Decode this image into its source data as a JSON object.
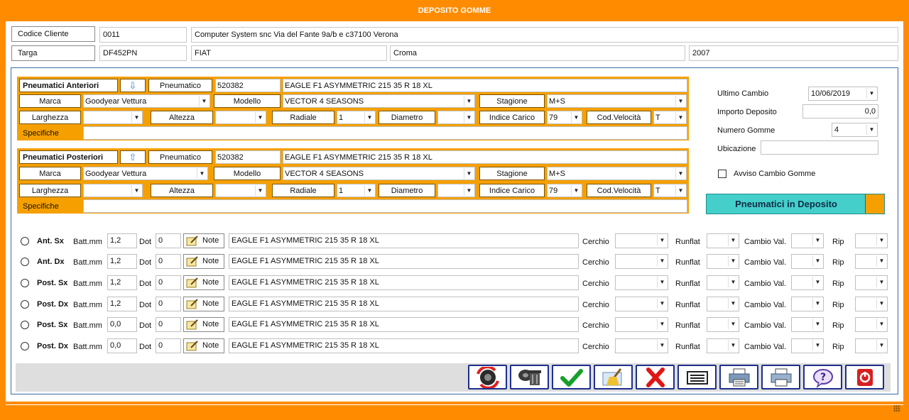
{
  "window": {
    "title": "DEPOSITO GOMME"
  },
  "header": {
    "codice_label": "Codice Cliente",
    "codice_value": "0011",
    "cliente_value": "Computer System snc Via del Fante 9a/b e c37100 Verona",
    "targa_label": "Targa",
    "targa_value": "DF452PN",
    "marca_value": "FIAT",
    "modello_value": "Croma",
    "anno_value": "2007"
  },
  "anteriori": {
    "title": "Pneumatici Anteriori",
    "pneumatico_btn": "Pneumatico",
    "codice": "520382",
    "descrizione": "EAGLE F1 ASYMMETRIC 215 35 R 18 XL",
    "marca_label": "Marca",
    "marca_value": "Goodyear Vettura",
    "modello_label": "Modello",
    "modello_value": "VECTOR 4 SEASONS",
    "stagione_label": "Stagione",
    "stagione_value": "M+S",
    "larghezza_label": "Larghezza",
    "larghezza_value": "",
    "altezza_label": "Altezza",
    "altezza_value": "",
    "radiale_label": "Radiale",
    "radiale_value": "1",
    "diametro_label": "Diametro",
    "diametro_value": "",
    "indice_label": "Indice Carico",
    "indice_value": "79",
    "velocita_label": "Cod.Velocità",
    "velocita_value": "T",
    "specifiche_label": "Specifiche",
    "specifiche_value": ""
  },
  "posteriori": {
    "title": "Pneumatici Posteriori",
    "pneumatico_btn": "Pneumatico",
    "codice": "520382",
    "descrizione": "EAGLE F1 ASYMMETRIC 215 35 R 18 XL",
    "marca_label": "Marca",
    "marca_value": "Goodyear Vettura",
    "modello_label": "Modello",
    "modello_value": "VECTOR 4 SEASONS",
    "stagione_label": "Stagione",
    "stagione_value": "M+S",
    "larghezza_label": "Larghezza",
    "larghezza_value": "",
    "altezza_label": "Altezza",
    "altezza_value": "",
    "radiale_label": "Radiale",
    "radiale_value": "1",
    "diametro_label": "Diametro",
    "diametro_value": "",
    "indice_label": "Indice Carico",
    "indice_value": "79",
    "velocita_label": "Cod.Velocità",
    "velocita_value": "T",
    "specifiche_label": "Specifiche",
    "specifiche_value": ""
  },
  "right_panel": {
    "ultimo_cambio_label": "Ultimo Cambio",
    "ultimo_cambio_value": "10/06/2019",
    "importo_label": "Importo Deposito",
    "importo_value": "0,0",
    "numero_label": "Numero Gomme",
    "numero_value": "4",
    "ubicazione_label": "Ubicazione",
    "ubicazione_value": "",
    "avviso_label": "Avviso Cambio Gomme",
    "deposito_button": "Pneumatici in Deposito"
  },
  "wheel_labels": {
    "batt": "Batt.mm",
    "dot": "Dot",
    "note": "Note",
    "cerchio": "Cerchio",
    "runflat": "Runflat",
    "cambio": "Cambio Val.",
    "rip": "Rip"
  },
  "wheels": [
    {
      "pos": "Ant. Sx",
      "batt": "1,2",
      "dot": "0",
      "desc": "EAGLE F1 ASYMMETRIC 215 35 R 18 XL"
    },
    {
      "pos": "Ant. Dx",
      "batt": "1,2",
      "dot": "0",
      "desc": "EAGLE F1 ASYMMETRIC 215 35 R 18 XL"
    },
    {
      "pos": "Post. Sx",
      "batt": "1,2",
      "dot": "0",
      "desc": "EAGLE F1 ASYMMETRIC 215 35 R 18 XL"
    },
    {
      "pos": "Post. Dx",
      "batt": "1,2",
      "dot": "0",
      "desc": "EAGLE F1 ASYMMETRIC 215 35 R 18 XL"
    },
    {
      "pos": "Post. Sx",
      "batt": "0,0",
      "dot": "0",
      "desc": "EAGLE F1 ASYMMETRIC 215 35 R 18 XL"
    },
    {
      "pos": "Post. Dx",
      "batt": "0,0",
      "dot": "0",
      "desc": "EAGLE F1 ASYMMETRIC 215 35 R 18 XL"
    }
  ],
  "toolbar": {
    "buttons": [
      "refresh-tire-icon",
      "delete-tires-icon",
      "confirm-icon",
      "clear-icon",
      "cancel-icon",
      "list-icon",
      "print-icon",
      "print-preview-icon",
      "help-icon",
      "exit-icon"
    ]
  }
}
